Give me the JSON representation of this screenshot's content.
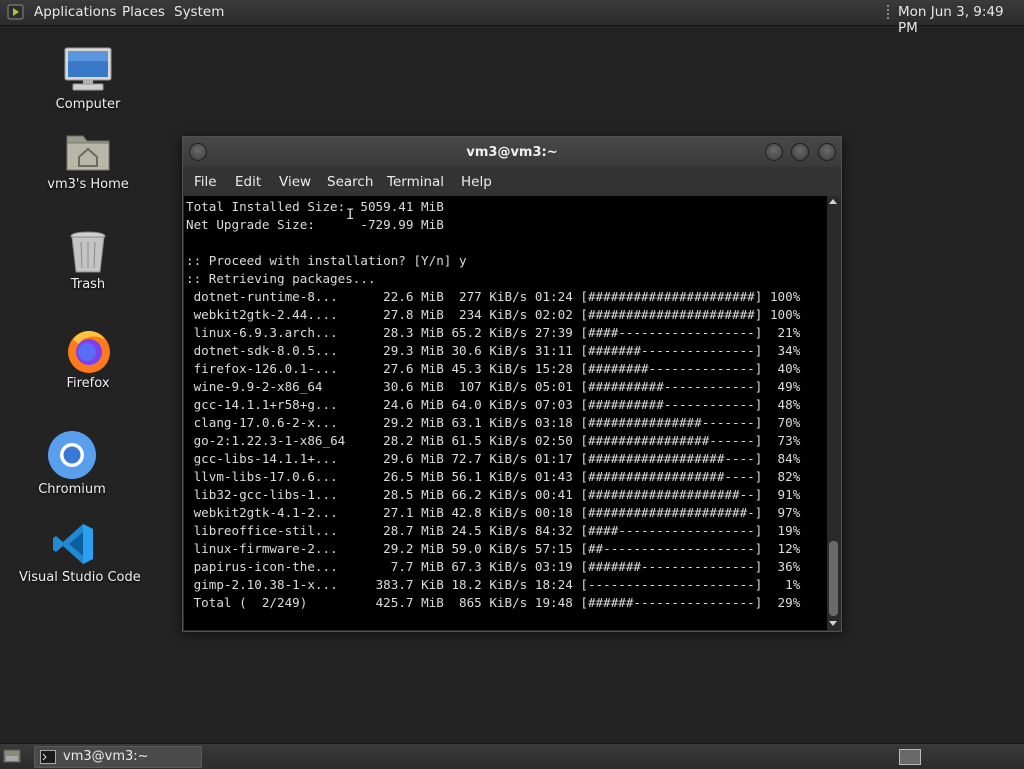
{
  "top_panel": {
    "menus": [
      "Applications",
      "Places",
      "System"
    ],
    "clock": "Mon Jun  3,  9:49 PM"
  },
  "desktop_icons": [
    {
      "label": "Computer",
      "icon": "computer-icon"
    },
    {
      "label": "vm3's Home",
      "icon": "home-folder-icon"
    },
    {
      "label": "Trash",
      "icon": "trash-icon"
    },
    {
      "label": "Firefox",
      "icon": "firefox-icon"
    },
    {
      "label": "Chromium",
      "icon": "chromium-icon"
    },
    {
      "label": "Visual Studio Code",
      "icon": "vscode-icon"
    }
  ],
  "terminal": {
    "title": "vm3@vm3:~",
    "menu": [
      "File",
      "Edit",
      "View",
      "Search",
      "Terminal",
      "Help"
    ],
    "summary": [
      "Total Installed Size:  5059.41 MiB",
      "Net Upgrade Size:      -729.99 MiB",
      "",
      ":: Proceed with installation? [Y/n] y",
      ":: Retrieving packages..."
    ],
    "downloads": [
      {
        "name": "dotnet-runtime-8...",
        "size": "22.6 MiB",
        "rate": "277 KiB/s",
        "eta": "01:24",
        "bar": "[######################]",
        "pct": "100%"
      },
      {
        "name": "webkit2gtk-2.44....",
        "size": "27.8 MiB",
        "rate": "234 KiB/s",
        "eta": "02:02",
        "bar": "[######################]",
        "pct": "100%"
      },
      {
        "name": "linux-6.9.3.arch...",
        "size": "28.3 MiB",
        "rate": "65.2 KiB/s",
        "eta": "27:39",
        "bar": "[####------------------]",
        "pct": "21%"
      },
      {
        "name": "dotnet-sdk-8.0.5...",
        "size": "29.3 MiB",
        "rate": "30.6 KiB/s",
        "eta": "31:11",
        "bar": "[#######---------------]",
        "pct": "34%"
      },
      {
        "name": "firefox-126.0.1-...",
        "size": "27.6 MiB",
        "rate": "45.3 KiB/s",
        "eta": "15:28",
        "bar": "[########--------------]",
        "pct": "40%"
      },
      {
        "name": "wine-9.9-2-x86_64",
        "size": "30.6 MiB",
        "rate": "107 KiB/s",
        "eta": "05:01",
        "bar": "[##########------------]",
        "pct": "49%"
      },
      {
        "name": "gcc-14.1.1+r58+g...",
        "size": "24.6 MiB",
        "rate": "64.0 KiB/s",
        "eta": "07:03",
        "bar": "[##########------------]",
        "pct": "48%"
      },
      {
        "name": "clang-17.0.6-2-x...",
        "size": "29.2 MiB",
        "rate": "63.1 KiB/s",
        "eta": "03:18",
        "bar": "[###############-------]",
        "pct": "70%"
      },
      {
        "name": "go-2:1.22.3-1-x86_64",
        "size": "28.2 MiB",
        "rate": "61.5 KiB/s",
        "eta": "02:50",
        "bar": "[################------]",
        "pct": "73%"
      },
      {
        "name": "gcc-libs-14.1.1+...",
        "size": "29.6 MiB",
        "rate": "72.7 KiB/s",
        "eta": "01:17",
        "bar": "[##################----]",
        "pct": "84%"
      },
      {
        "name": "llvm-libs-17.0.6...",
        "size": "26.5 MiB",
        "rate": "56.1 KiB/s",
        "eta": "01:43",
        "bar": "[##################----]",
        "pct": "82%"
      },
      {
        "name": "lib32-gcc-libs-1...",
        "size": "28.5 MiB",
        "rate": "66.2 KiB/s",
        "eta": "00:41",
        "bar": "[####################--]",
        "pct": "91%"
      },
      {
        "name": "webkit2gtk-4.1-2...",
        "size": "27.1 MiB",
        "rate": "42.8 KiB/s",
        "eta": "00:18",
        "bar": "[#####################-]",
        "pct": "97%"
      },
      {
        "name": "libreoffice-stil...",
        "size": "28.7 MiB",
        "rate": "24.5 KiB/s",
        "eta": "84:32",
        "bar": "[####------------------]",
        "pct": "19%"
      },
      {
        "name": "linux-firmware-2...",
        "size": "29.2 MiB",
        "rate": "59.0 KiB/s",
        "eta": "57:15",
        "bar": "[##--------------------]",
        "pct": "12%"
      },
      {
        "name": "papirus-icon-the...",
        "size": "7.7 MiB",
        "rate": "67.3 KiB/s",
        "eta": "03:19",
        "bar": "[#######---------------]",
        "pct": "36%"
      },
      {
        "name": "gimp-2.10.38-1-x...",
        "size": "383.7 KiB",
        "rate": "18.2 KiB/s",
        "eta": "18:24",
        "bar": "[----------------------]",
        "pct": "1%"
      },
      {
        "name": "Total (  2/249)",
        "size": "425.7 MiB",
        "rate": "865 KiB/s",
        "eta": "19:48",
        "bar": "[######----------------]",
        "pct": "29%"
      }
    ]
  },
  "taskbar": {
    "task_label": "vm3@vm3:~"
  }
}
